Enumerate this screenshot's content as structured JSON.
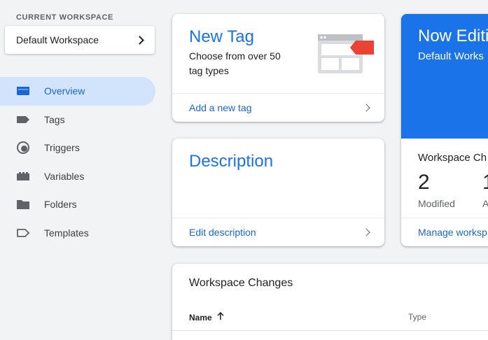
{
  "workspace": {
    "label": "CURRENT WORKSPACE",
    "name": "Default Workspace"
  },
  "nav": {
    "items": [
      {
        "label": "Overview",
        "icon": "overview-icon",
        "active": true
      },
      {
        "label": "Tags",
        "icon": "tag-icon"
      },
      {
        "label": "Triggers",
        "icon": "trigger-icon"
      },
      {
        "label": "Variables",
        "icon": "variables-icon"
      },
      {
        "label": "Folders",
        "icon": "folder-icon"
      },
      {
        "label": "Templates",
        "icon": "template-icon"
      }
    ]
  },
  "new_tag": {
    "title": "New Tag",
    "subtitle": "Choose from over 50 tag types",
    "link": "Add a new tag"
  },
  "description": {
    "title": "Description",
    "link": "Edit description"
  },
  "now_editing": {
    "title": "Now Editi",
    "workspace": "Default Works",
    "changes_label": "Workspace Ch",
    "modified_count": "2",
    "modified_label": "Modified",
    "added_count": "1",
    "added_label": "A",
    "link": "Manage worksp"
  },
  "workspace_changes": {
    "title": "Workspace Changes",
    "col_name": "Name",
    "col_type": "Type"
  },
  "colors": {
    "accent": "#1a73e8",
    "active_bg": "#d2e3fc",
    "tag_red": "#ea4335"
  }
}
